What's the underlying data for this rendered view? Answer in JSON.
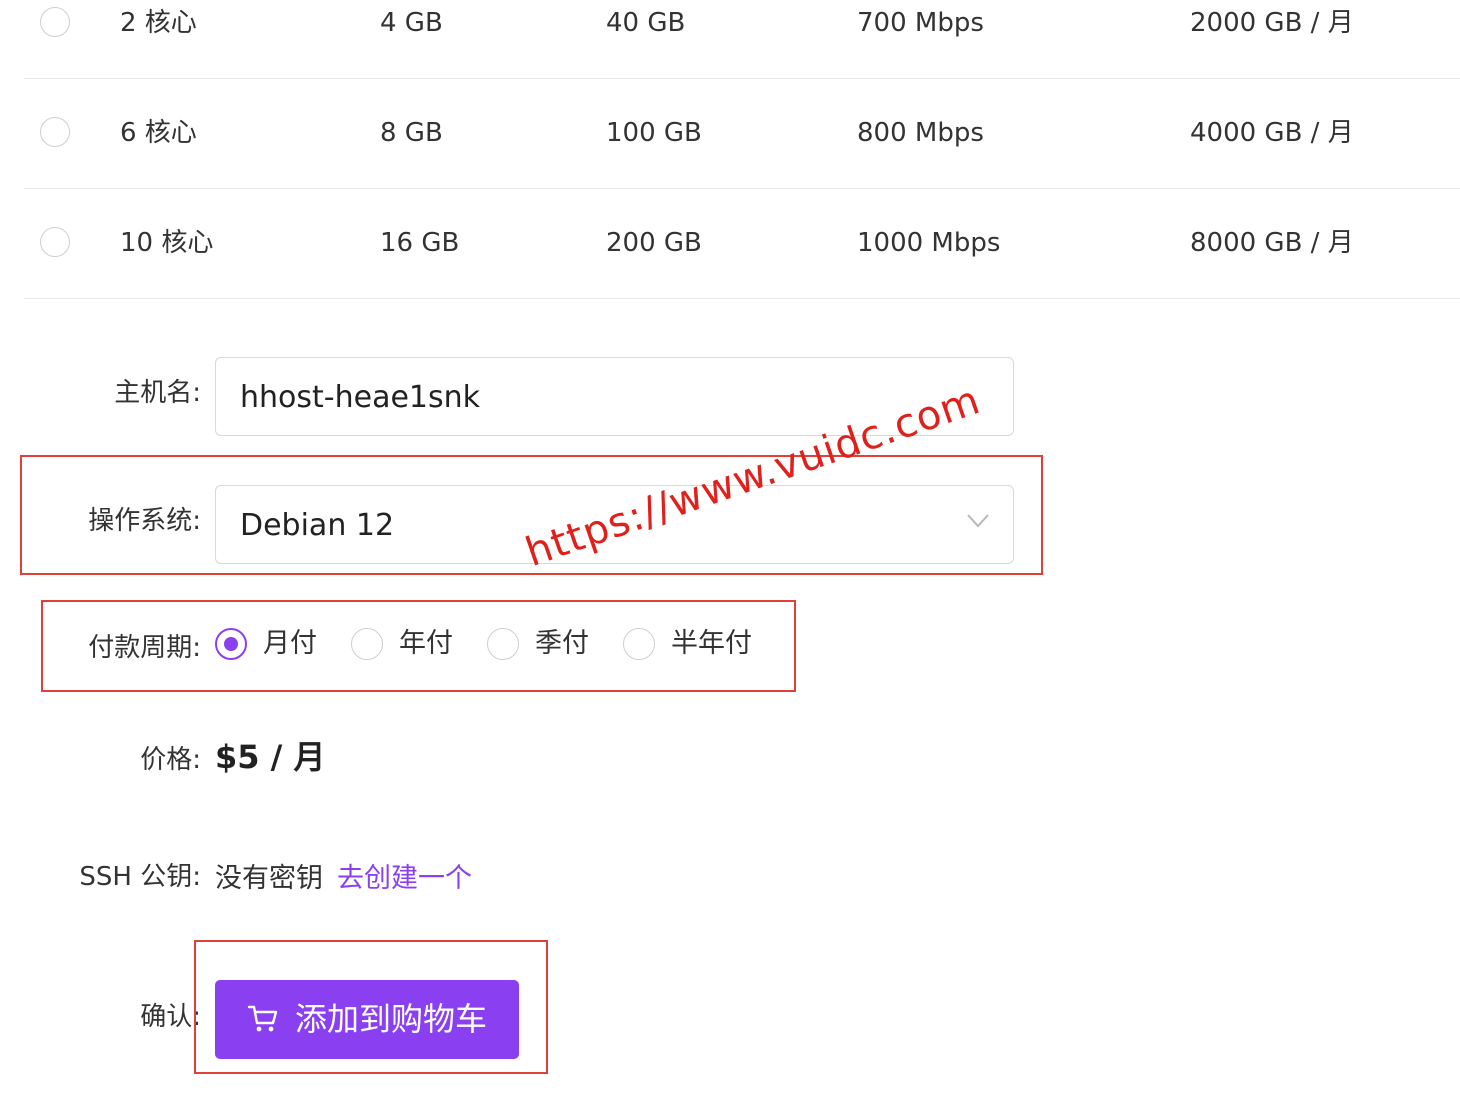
{
  "plans": [
    {
      "cpu": "2 核心",
      "memory": "4 GB",
      "disk": "40 GB",
      "bandwidth": "700 Mbps",
      "traffic": "2000 GB / 月",
      "selected": false
    },
    {
      "cpu": "6 核心",
      "memory": "8 GB",
      "disk": "100 GB",
      "bandwidth": "800 Mbps",
      "traffic": "4000 GB / 月",
      "selected": false
    },
    {
      "cpu": "10 核心",
      "memory": "16 GB",
      "disk": "200 GB",
      "bandwidth": "1000 Mbps",
      "traffic": "8000 GB / 月",
      "selected": false
    }
  ],
  "form": {
    "hostname": {
      "label": "主机名:",
      "value": "hhost-heae1snk"
    },
    "os": {
      "label": "操作系统:",
      "value": "Debian 12"
    },
    "billing": {
      "label": "付款周期:",
      "options": [
        "月付",
        "年付",
        "季付",
        "半年付"
      ],
      "selected": "月付"
    },
    "price": {
      "label": "价格:",
      "value": "$5 / 月"
    },
    "ssh": {
      "label": "SSH 公钥:",
      "none_text": "没有密钥",
      "create_link": "去创建一个"
    },
    "confirm": {
      "label": "确认:",
      "button": "添加到购物车"
    }
  },
  "watermark": "https://www.vuidc.com",
  "colors": {
    "accent": "#8a3ff0",
    "highlight": "#e0403a",
    "watermark": "#e0201b"
  }
}
